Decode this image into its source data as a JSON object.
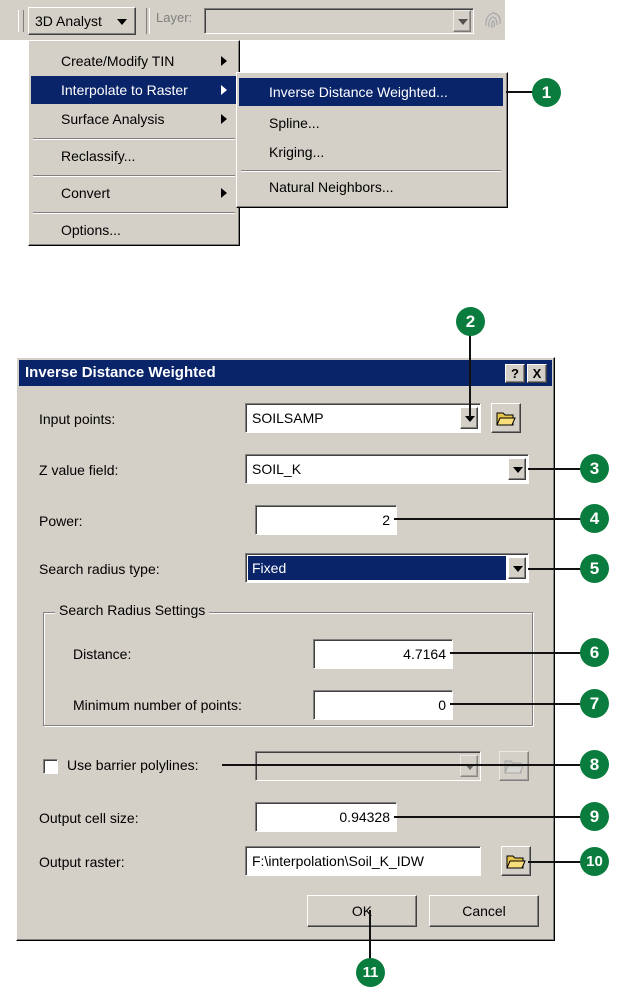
{
  "toolbar": {
    "menu_label": "3D Analyst",
    "layer_label": "Layer:",
    "layer_value": ""
  },
  "menu": {
    "items": [
      {
        "label": "Create/Modify TIN"
      },
      {
        "label": "Interpolate to Raster"
      },
      {
        "label": "Surface Analysis"
      },
      {
        "label": "Reclassify..."
      },
      {
        "label": "Convert"
      },
      {
        "label": "Options..."
      }
    ],
    "submenu": [
      {
        "label": "Inverse Distance Weighted..."
      },
      {
        "label": "Spline..."
      },
      {
        "label": "Kriging..."
      },
      {
        "label": "Natural Neighbors..."
      }
    ]
  },
  "dialog": {
    "title": "Inverse Distance Weighted",
    "help_label": "?",
    "close_label": "X",
    "input_points_label": "Input points:",
    "input_points_value": "SOILSAMP",
    "z_field_label": "Z value field:",
    "z_field_value": "SOIL_K",
    "power_label": "Power:",
    "power_value": "2",
    "search_type_label": "Search radius type:",
    "search_type_value": "Fixed",
    "group_label": "Search Radius Settings",
    "distance_label": "Distance:",
    "distance_value": "4.7164",
    "min_points_label": "Minimum number of points:",
    "min_points_value": "0",
    "barrier_label": "Use barrier polylines:",
    "cell_size_label": "Output cell size:",
    "cell_size_value": "0.94328",
    "output_raster_label": "Output raster:",
    "output_raster_value": "F:\\interpolation\\Soil_K_IDW",
    "ok_label": "OK",
    "cancel_label": "Cancel"
  },
  "callouts": [
    "1",
    "2",
    "3",
    "4",
    "5",
    "6",
    "7",
    "8",
    "9",
    "10",
    "11"
  ],
  "colors": {
    "callout": "#0a7c3d",
    "title_bar": "#0a246a",
    "face": "#d4d0c8",
    "selection": "#0a246a"
  }
}
